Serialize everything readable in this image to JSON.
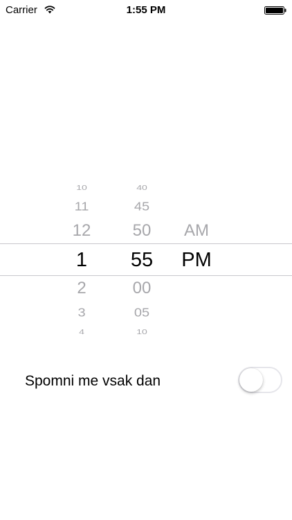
{
  "status_bar": {
    "carrier": "Carrier",
    "time": "1:55 PM",
    "icons": [
      "wifi-icon",
      "battery-icon"
    ]
  },
  "time_picker": {
    "hours": [
      "10",
      "11",
      "12",
      "1",
      "2",
      "3",
      "4"
    ],
    "minutes": [
      "40",
      "45",
      "50",
      "55",
      "00",
      "05",
      "10"
    ],
    "period": [
      "AM",
      "PM"
    ],
    "selected": {
      "hour": "1",
      "minute": "55",
      "period": "PM"
    }
  },
  "reminder": {
    "label": "Spomni me vsak dan",
    "toggle_on": false
  },
  "colors": {
    "selected_text": "#000000",
    "faded_text": "#a7a7ab",
    "separator": "#c8c7cc",
    "toggle_border": "#e5e5ea"
  }
}
